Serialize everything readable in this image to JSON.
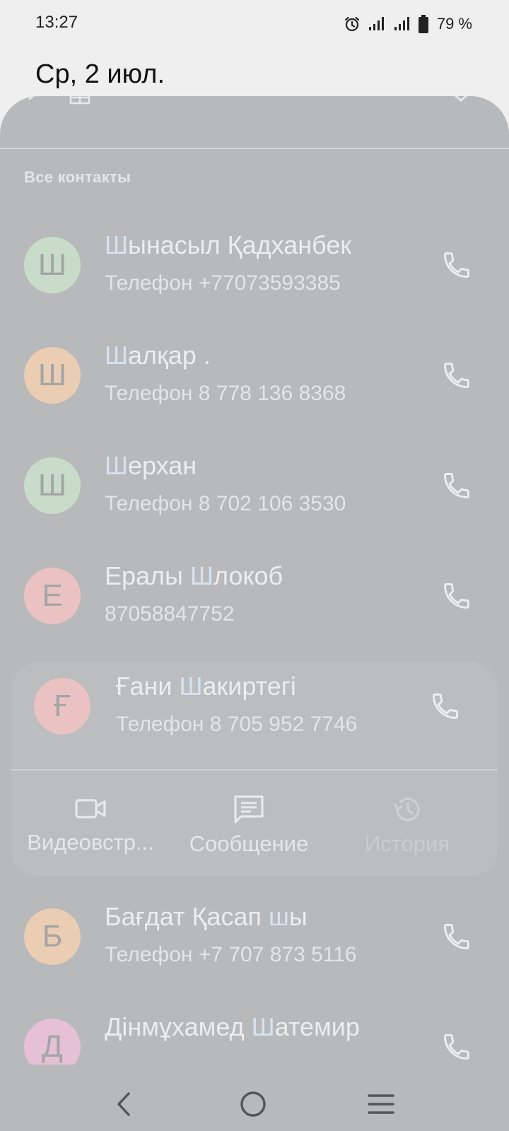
{
  "status_bar": {
    "time": "13:27",
    "battery_percent": "79 %",
    "icons": [
      "alarm-icon",
      "signal-sim1-icon",
      "signal-sim2-icon",
      "battery-icon"
    ]
  },
  "date": "Ср, 2 июл.",
  "section_title": "Все контакты",
  "contacts": [
    {
      "initial": "Ш",
      "avatar_color": "#c9dcca",
      "name_hl": "Ш",
      "name_rest": "ынасыл Қадханбек",
      "name_pre": "",
      "phone": "Телефон +77073593385"
    },
    {
      "initial": "Ш",
      "avatar_color": "#ebcdb3",
      "name_hl": "Ш",
      "name_rest": "алқар .",
      "name_pre": "",
      "phone": "Телефон 8 778 136 8368"
    },
    {
      "initial": "Ш",
      "avatar_color": "#c9dcca",
      "name_hl": "Ш",
      "name_rest": "ерхан",
      "name_pre": "",
      "phone": "Телефон 8 702 106 3530"
    },
    {
      "initial": "Е",
      "avatar_color": "#ebc2c2",
      "name_pre": "Ералы ",
      "name_hl": "Ш",
      "name_rest": "локоб",
      "phone": "87058847752"
    },
    {
      "initial": "Ғ",
      "avatar_color": "#ebc2c2",
      "name_pre": "Ғани ",
      "name_hl": "Ш",
      "name_rest": "акиртегі",
      "phone": "Телефон 8 705 952 7746"
    },
    {
      "initial": "Б",
      "avatar_color": "#ebcdb3",
      "name_pre": "Бағдат Қасап ",
      "name_hl": "ш",
      "name_rest": "ы",
      "phone": "Телефон +7 707 873 5116"
    },
    {
      "initial": "Д",
      "avatar_color": "#e6c0d6",
      "name_pre": "Дінмұхамед ",
      "name_hl": "Ш",
      "name_rest": "атемир",
      "phone": ""
    }
  ],
  "actions": [
    {
      "label": "Видеовстр...",
      "icon": "video-call-icon"
    },
    {
      "label": "Сообщение",
      "icon": "message-icon"
    },
    {
      "label": "История",
      "icon": "history-icon"
    }
  ],
  "nav": {
    "icons": [
      "back-icon",
      "home-icon",
      "recents-icon"
    ]
  }
}
